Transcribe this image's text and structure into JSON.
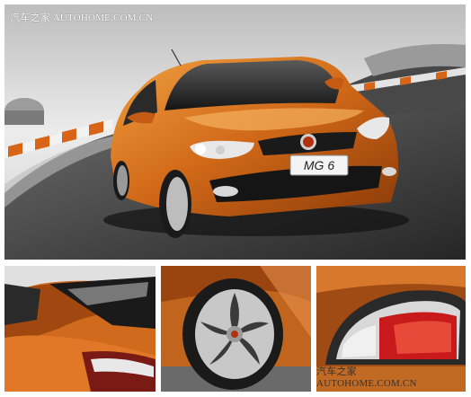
{
  "watermarks": {
    "top": "汽车之家 AUTOHOME.COM.CN",
    "bottom": "汽车之家 AUTOHOME.COM.CN"
  },
  "plate": {
    "text": "MG 6"
  },
  "colors": {
    "car_orange": "#c85a10",
    "car_highlight": "#f09a3a",
    "sky": "#e8e8e8",
    "road": "#3a3a3a"
  }
}
